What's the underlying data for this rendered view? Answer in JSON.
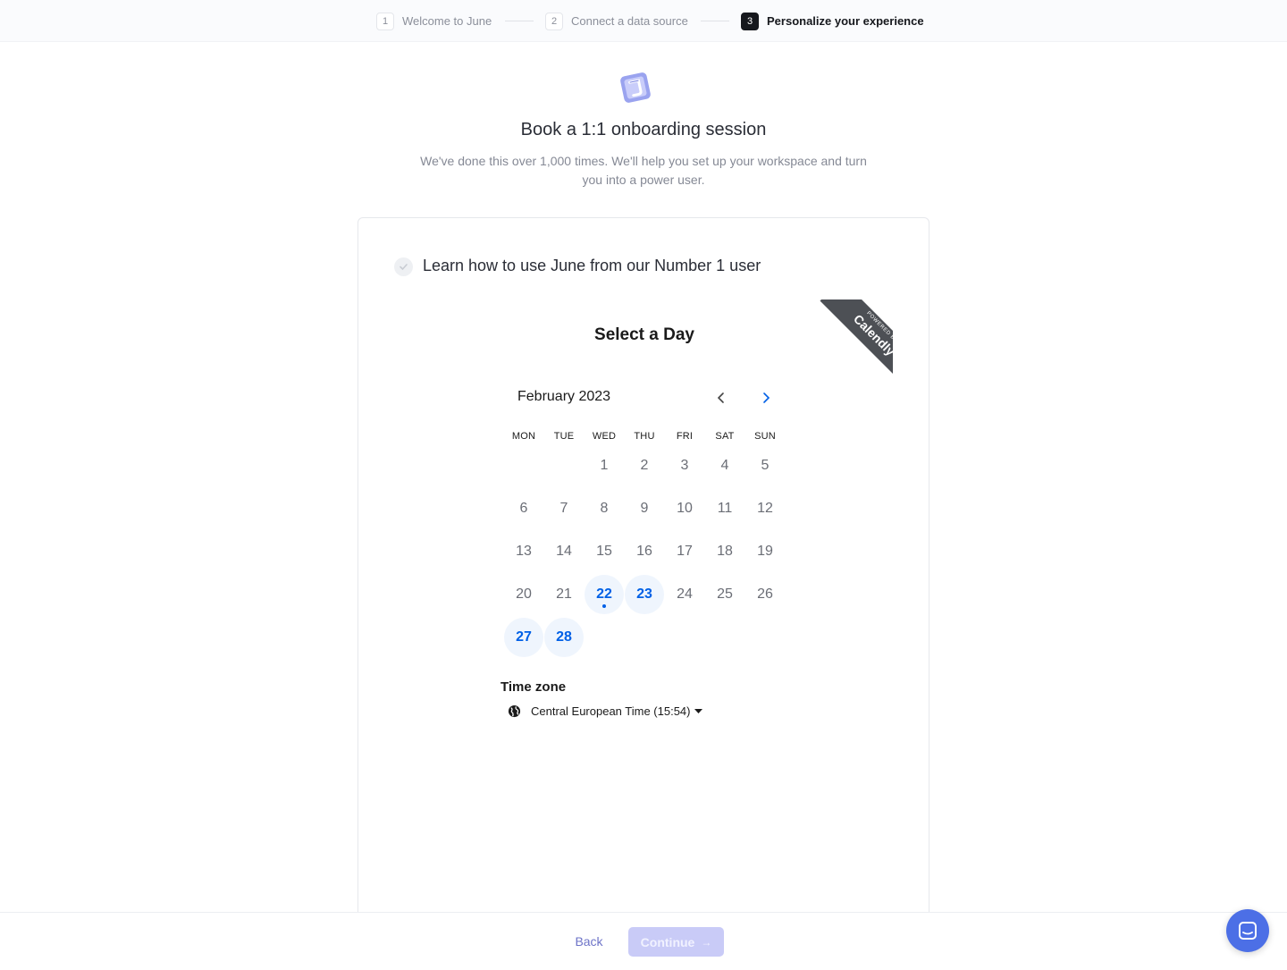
{
  "steps": [
    {
      "num": "1",
      "label": "Welcome to June"
    },
    {
      "num": "2",
      "label": "Connect a data source"
    },
    {
      "num": "3",
      "label": "Personalize your experience"
    }
  ],
  "header": {
    "title": "Book a 1:1 onboarding session",
    "subtitle": "We've done this over 1,000 times. We'll help you set up your workspace and turn you into a power user."
  },
  "event": {
    "title": "Learn how to use June from our Number 1 user"
  },
  "badge": {
    "small": "POWERED BY",
    "brand": "Calendly"
  },
  "calendar": {
    "heading": "Select a Day",
    "month": "February 2023",
    "weekdays": [
      "MON",
      "TUE",
      "WED",
      "THU",
      "FRI",
      "SAT",
      "SUN"
    ],
    "days": [
      "1",
      "2",
      "3",
      "4",
      "5",
      "6",
      "7",
      "8",
      "9",
      "10",
      "11",
      "12",
      "13",
      "14",
      "15",
      "16",
      "17",
      "18",
      "19",
      "20",
      "21",
      "22",
      "23",
      "24",
      "25",
      "26",
      "27",
      "28"
    ],
    "available_days": [
      "22",
      "23",
      "27",
      "28"
    ],
    "today": "22"
  },
  "timezone": {
    "label": "Time zone",
    "value": "Central European Time (15:54)"
  },
  "footer": {
    "back_label": "Back",
    "continue_label": "Continue"
  },
  "colors": {
    "accent": "#6e74c8",
    "available_day": "#0060e6",
    "chat_button": "#4c6fe6"
  },
  "icons": {
    "logo": "june-logo",
    "event_check": "check-circle-icon",
    "prev": "chevron-left-icon",
    "next": "chevron-right-icon",
    "globe": "globe-icon",
    "caret": "caret-down-icon",
    "chat": "chat-icon"
  }
}
